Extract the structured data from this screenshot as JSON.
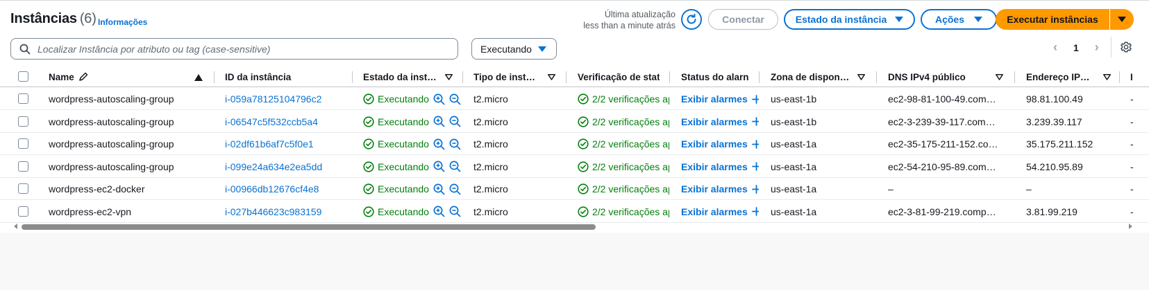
{
  "header": {
    "title": "Instâncias",
    "count": "(6)",
    "info_link": "Informações",
    "last_update_label": "Última atualização",
    "last_update_value": "less than a minute atrás",
    "connect_label": "Conectar",
    "state_label": "Estado da instância",
    "actions_label": "Ações",
    "launch_label": "Executar instâncias"
  },
  "filter": {
    "search_placeholder": "Localizar Instância por atributo ou tag (case-sensitive)",
    "state_filter": "Executando"
  },
  "pagination": {
    "page": "1"
  },
  "columns": {
    "name": "Name",
    "id": "ID da instância",
    "state": "Estado da inst…",
    "type": "Tipo de inst…",
    "check": "Verificação de stat",
    "alarm": "Status do alarn",
    "zone": "Zona de dispon…",
    "dns": "DNS IPv4 público",
    "ip": "Endereço IP…",
    "extra": "I"
  },
  "rows": [
    {
      "name": "wordpress-autoscaling-group",
      "id": "i-059a78125104796c2",
      "state": "Executando",
      "type": "t2.micro",
      "check": "2/2 verificações ap",
      "alarm": "Exibir alarmes",
      "zone": "us-east-1b",
      "dns": "ec2-98-81-100-49.com…",
      "ip": "98.81.100.49",
      "extra": "-"
    },
    {
      "name": "wordpress-autoscaling-group",
      "id": "i-06547c5f532ccb5a4",
      "state": "Executando",
      "type": "t2.micro",
      "check": "2/2 verificações ap",
      "alarm": "Exibir alarmes",
      "zone": "us-east-1b",
      "dns": "ec2-3-239-39-117.com…",
      "ip": "3.239.39.117",
      "extra": "-"
    },
    {
      "name": "wordpress-autoscaling-group",
      "id": "i-02df61b6af7c5f0e1",
      "state": "Executando",
      "type": "t2.micro",
      "check": "2/2 verificações ap",
      "alarm": "Exibir alarmes",
      "zone": "us-east-1a",
      "dns": "ec2-35-175-211-152.co…",
      "ip": "35.175.211.152",
      "extra": "-"
    },
    {
      "name": "wordpress-autoscaling-group",
      "id": "i-099e24a634e2ea5dd",
      "state": "Executando",
      "type": "t2.micro",
      "check": "2/2 verificações ap",
      "alarm": "Exibir alarmes",
      "zone": "us-east-1a",
      "dns": "ec2-54-210-95-89.com…",
      "ip": "54.210.95.89",
      "extra": "-"
    },
    {
      "name": "wordpress-ec2-docker",
      "id": "i-00966db12676cf4e8",
      "state": "Executando",
      "type": "t2.micro",
      "check": "2/2 verificações ap",
      "alarm": "Exibir alarmes",
      "zone": "us-east-1a",
      "dns": "–",
      "ip": "–",
      "extra": "-"
    },
    {
      "name": "wordpress-ec2-vpn",
      "id": "i-027b446623c983159",
      "state": "Executando",
      "type": "t2.micro",
      "check": "2/2 verificações ap",
      "alarm": "Exibir alarmes",
      "zone": "us-east-1a",
      "dns": "ec2-3-81-99-219.comp…",
      "ip": "3.81.99.219",
      "extra": "-"
    }
  ],
  "colors": {
    "link_blue": "#0972d3",
    "status_green": "#037f0c",
    "primary_orange": "#ff9900"
  }
}
